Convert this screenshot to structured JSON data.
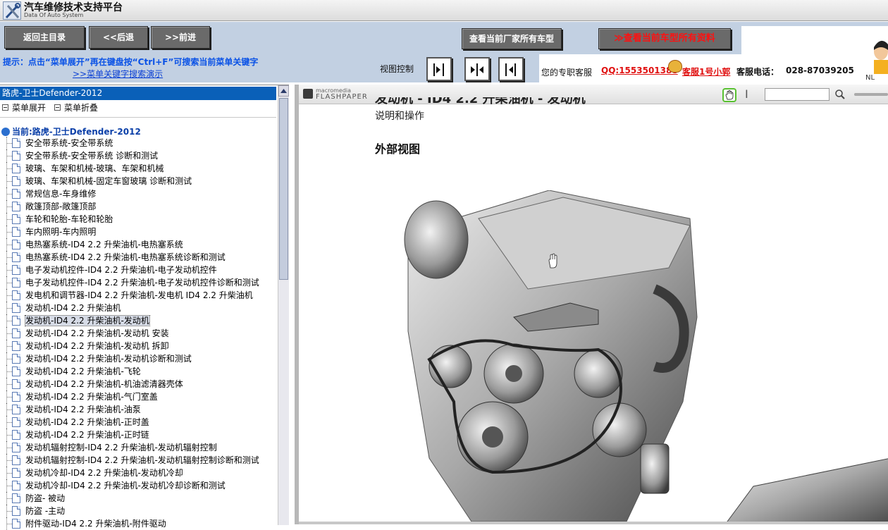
{
  "header": {
    "title": "汽车维修技术支持平台",
    "subtitle": "Data Of Auto System"
  },
  "toolbar": {
    "home_label": "返回主目录",
    "back_label": "<<后退",
    "forward_label": ">>前进",
    "models_label": "查看当前厂家所有车型",
    "all_data_label": "≫查看当前车型所有资料"
  },
  "infobar": {
    "tip": "提示：点击“菜单展开”再在键盘按“Ctrl+F”可搜索当前菜单关键字",
    "tip_link": ">>菜单关键字搜索演示",
    "view_control_label": "视图控制",
    "service_label": "您的专职客服",
    "qq": "QQ:1553501388",
    "agent": "客服1号小郭",
    "phone_label": "客服电话：",
    "phone": "028-87039205"
  },
  "left_panel": {
    "title": "路虎-卫士Defender-2012",
    "expand_label": "菜单展开",
    "collapse_label": "菜单折叠",
    "root_label": "当前:路虎-卫士Defender-2012",
    "items": [
      "安全带系统-安全带系统",
      "安全带系统-安全带系统 诊断和测试",
      "玻璃、车架和机械-玻璃、车架和机械",
      "玻璃、车架和机械-固定车窗玻璃 诊断和测试",
      "常规信息-车身维修",
      "敞篷顶部-敞篷顶部",
      "车轮和轮胎-车轮和轮胎",
      "车内照明-车内照明",
      "电热塞系统-ID4 2.2 升柴油机-电热塞系统",
      "电热塞系统-ID4 2.2 升柴油机-电热塞系统诊断和测试",
      "电子发动机控件-ID4 2.2 升柴油机-电子发动机控件",
      "电子发动机控件-ID4 2.2 升柴油机-电子发动机控件诊断和测试",
      "发电机和调节器-ID4 2.2 升柴油机-发电机  ID4 2.2 升柴油机",
      "发动机-ID4 2.2 升柴油机",
      "发动机-ID4 2.2 升柴油机-发动机",
      "发动机-ID4 2.2 升柴油机-发动机 安装",
      "发动机-ID4 2.2 升柴油机-发动机 拆卸",
      "发动机-ID4 2.2 升柴油机-发动机诊断和测试",
      "发动机-ID4 2.2 升柴油机-飞轮",
      "发动机-ID4 2.2 升柴油机-机油滤清器壳体",
      "发动机-ID4 2.2 升柴油机-气门室盖",
      "发动机-ID4 2.2 升柴油机-油泵",
      "发动机-ID4 2.2 升柴油机-正时盖",
      "发动机-ID4 2.2 升柴油机-正时链",
      "发动机辐射控制-ID4 2.2 升柴油机-发动机辐射控制",
      "发动机辐射控制-ID4 2.2 升柴油机-发动机辐射控制诊断和测试",
      "发动机冷却-ID4 2.2 升柴油机-发动机冷却",
      "发动机冷却-ID4 2.2 升柴油机-发动机冷却诊断和测试",
      "防盗- 被动",
      "防盗 -主动",
      "附件驱动-ID4 2.2 升柴油机-附件驱动"
    ],
    "selected_index": 14
  },
  "viewer": {
    "brand_top": "macromedia",
    "brand": "FLASHPAPER",
    "heading_partial": "发动机 - ID4 2.2 升柴油机 - 发动机",
    "subheading": "说明和操作",
    "section_title": "外部视图"
  },
  "colors": {
    "toolbar_bg": "#c2d0e2",
    "button_bg": "#6a6a6a",
    "tip_blue": "#0a52e6",
    "alert_red": "#e01010",
    "tree_selected_bar": "#0a60b8"
  }
}
